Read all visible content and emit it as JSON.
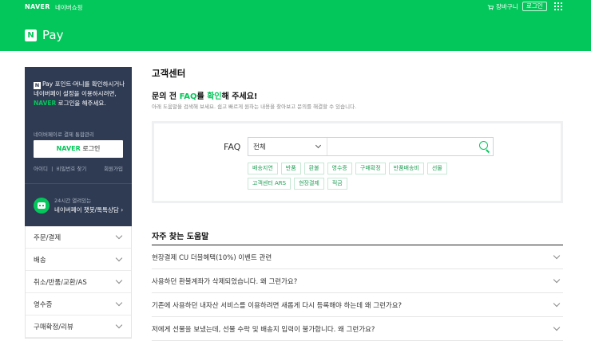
{
  "topbar": {
    "naver": "NAVER",
    "shopping": "네이버쇼핑",
    "cart": "장바구니",
    "login": "로그인"
  },
  "header": {
    "logo_letter": "N",
    "title": "Pay"
  },
  "sidebar": {
    "promo_line1": "Pay 포인트·머니를 확인하시거나",
    "promo_line2": "네이버페이 설정을 이용하시려면,",
    "promo_naver": "NAVER",
    "promo_line3": "로그인을 해주세요.",
    "integrated_label": "네이버페이로 결제 통합관리",
    "login_naver": "NAVER",
    "login_text": "로그인",
    "find_id": "아이디",
    "find_pw": "비밀번호 찾기",
    "join": "회원가입",
    "chat_line1": "24시간 열려있는",
    "chat_line2": "네이버페이 챗봇/톡톡상담",
    "menu": [
      "주문/결제",
      "배송",
      "취소/반품/교환/AS",
      "영수증",
      "구매확정/리뷰"
    ]
  },
  "main": {
    "title": "고객센터",
    "ask_pre": "문의 전 ",
    "ask_faq": "FAQ",
    "ask_mid": "를 ",
    "ask_check": "확인",
    "ask_post": "해 주세요!",
    "ask_sub": "아래 도움말을 검색해 보세요. 쉽고 빠르게 원하는 내용을 찾아보고 문의를 해결할 수 있습니다.",
    "faq_label": "FAQ",
    "search_select": "전체",
    "search_placeholder": "",
    "chips_row1": [
      "배송지연",
      "반품",
      "환불",
      "영수증",
      "구매확정",
      "반품배송비",
      "선물"
    ],
    "chips_row2": [
      "고객센터 ARS",
      "현장결제",
      "적금"
    ],
    "faq_section_title": "자주 찾는 도움말",
    "faq_items": [
      "현장결제 CU 더블혜택(10%) 이벤트 관련",
      "사용하던 환불계좌가 삭제되었습니다. 왜 그런가요?",
      "기존에 사용하던 내자산 서비스를 이용하려면 새롭게 다시 등록해야 하는데 왜 그런가요?",
      "저에게 선물을 보냈는데, 선물 수락 및 배송지 입력이 불가합니다. 왜 그런가요?"
    ]
  },
  "colors": {
    "brand_green": "#03c75a",
    "sidebar_dark": "#2f3b53"
  }
}
